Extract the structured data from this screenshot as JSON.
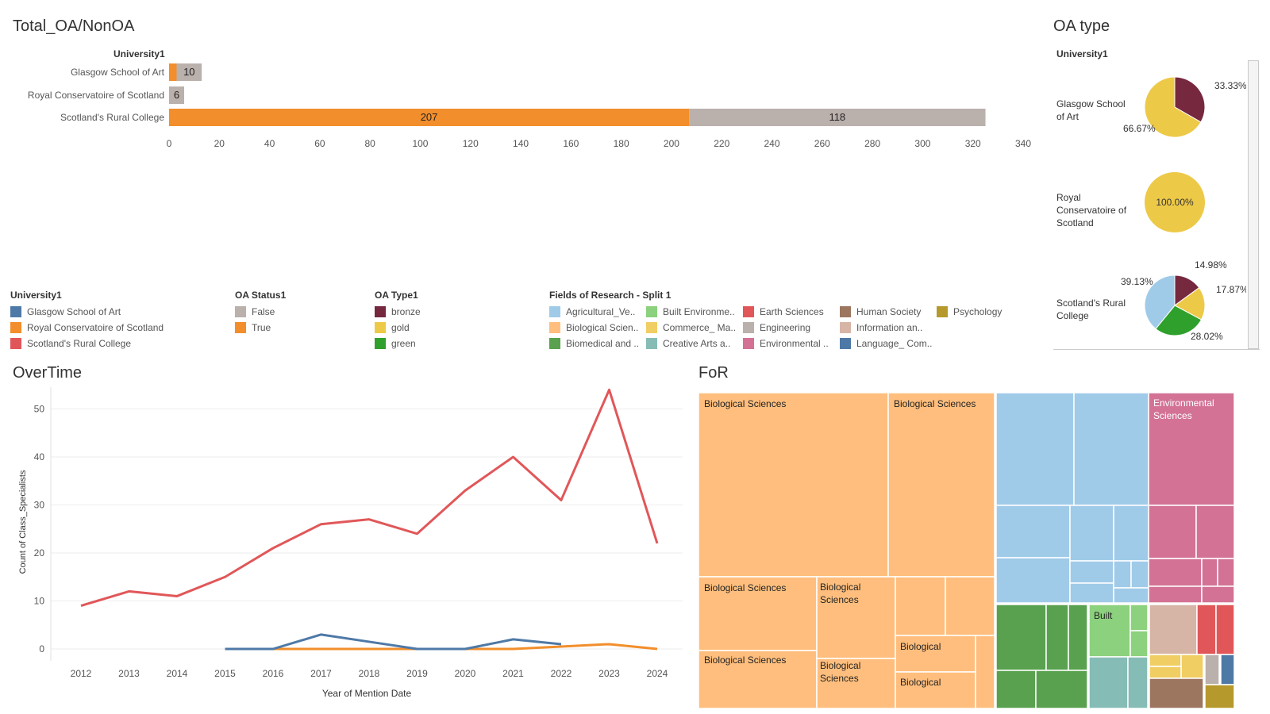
{
  "titles": {
    "total": "Total_OA/NonOA",
    "oa_type": "OA type",
    "overtime": "OverTime",
    "for": "FoR"
  },
  "bar_header": "University1",
  "pie_header": "University1",
  "colors": {
    "oa_true": "#f28e2b",
    "oa_false": "#bab0ac",
    "bronze": "#76283f",
    "gold": "#edc948",
    "green": "#30a02c",
    "glasgow": "#4e79a7",
    "royal": "#f28e2b",
    "rural": "#e15759"
  },
  "legends": {
    "university": {
      "title": "University1",
      "items": [
        {
          "label": "Glasgow School of Art",
          "color": "#4e79a7"
        },
        {
          "label": "Royal Conservatoire of Scotland",
          "color": "#f28e2b"
        },
        {
          "label": "Scotland's Rural College",
          "color": "#e15759"
        }
      ]
    },
    "oa_status": {
      "title": "OA Status1",
      "items": [
        {
          "label": "False",
          "color": "#bab0ac"
        },
        {
          "label": "True",
          "color": "#f28e2b"
        }
      ]
    },
    "oa_type": {
      "title": "OA Type1",
      "items": [
        {
          "label": "bronze",
          "color": "#76283f"
        },
        {
          "label": "gold",
          "color": "#edc948"
        },
        {
          "label": "green",
          "color": "#30a02c"
        }
      ]
    },
    "fields": {
      "title": "Fields of Research - Split 1",
      "items": [
        {
          "label": "Agricultural_Ve..",
          "color": "#a0cbe8"
        },
        {
          "label": "Built Environme..",
          "color": "#8cd17d"
        },
        {
          "label": "Earth Sciences",
          "color": "#e15759"
        },
        {
          "label": "Human Society",
          "color": "#9d7660"
        },
        {
          "label": "Psychology",
          "color": "#b6992d"
        },
        {
          "label": "Biological Scien..",
          "color": "#ffbe7d"
        },
        {
          "label": "Commerce_ Ma..",
          "color": "#f1ce63"
        },
        {
          "label": "Engineering",
          "color": "#bab0ac"
        },
        {
          "label": "Information an..",
          "color": "#d7b5a6"
        },
        {
          "label": "",
          "color": ""
        },
        {
          "label": "Biomedical and ..",
          "color": "#59a14f"
        },
        {
          "label": "Creative Arts a..",
          "color": "#86bcb6"
        },
        {
          "label": "Environmental ..",
          "color": "#d37295"
        },
        {
          "label": "Language_ Com..",
          "color": "#4e79a7"
        },
        {
          "label": "",
          "color": ""
        }
      ]
    }
  },
  "pies": [
    {
      "label": "Glasgow School of Art",
      "labels_text": [
        "33.33%",
        "66.67%"
      ]
    },
    {
      "label": "Royal Conservatoire of Scotland",
      "labels_text": [
        "100.00%"
      ]
    },
    {
      "label": "Scotland's Rural College",
      "labels_text": [
        "14.98%",
        "17.87%",
        "28.02%",
        "39.13%"
      ]
    }
  ],
  "treemap_labels": {
    "bio1": "Biological Sciences",
    "bio2": "Biological Sciences",
    "bio3": "Biological Sciences",
    "bio4": "Biological Sciences",
    "bio5": "Biological Sciences",
    "bio6": "Biological Sciences",
    "bio7": "Biological",
    "bio8": "Biological",
    "env": "Environmental Sciences",
    "built": "Built"
  },
  "chart_data": [
    {
      "type": "bar",
      "title": "Total_OA/NonOA",
      "categories": [
        "Glasgow School of Art",
        "Royal Conservatoire of Scotland",
        "Scotland's Rural College"
      ],
      "series": [
        {
          "name": "True",
          "values": [
            3,
            0,
            207
          ]
        },
        {
          "name": "False",
          "values": [
            10,
            6,
            118
          ]
        }
      ],
      "data_labels": [
        "10",
        "6",
        "207",
        "118"
      ],
      "xlim": [
        0,
        340
      ],
      "x_ticks": [
        "0",
        "20",
        "40",
        "60",
        "80",
        "100",
        "120",
        "140",
        "160",
        "180",
        "200",
        "220",
        "240",
        "260",
        "280",
        "300",
        "320",
        "340"
      ]
    },
    {
      "type": "pie",
      "title": "OA type",
      "charts": [
        {
          "category": "Glasgow School of Art",
          "slices": [
            {
              "name": "bronze",
              "value": 33.33
            },
            {
              "name": "gold",
              "value": 66.67
            }
          ]
        },
        {
          "category": "Royal Conservatoire of Scotland",
          "slices": [
            {
              "name": "gold",
              "value": 100.0
            }
          ]
        },
        {
          "category": "Scotland's Rural College",
          "slices": [
            {
              "name": "bronze",
              "value": 14.98
            },
            {
              "name": "gold",
              "value": 17.87
            },
            {
              "name": "green",
              "value": 28.02
            },
            {
              "name": "agricultural",
              "value": 39.13
            }
          ]
        }
      ]
    },
    {
      "type": "line",
      "title": "OverTime",
      "xlabel": "Year of Mention Date",
      "ylabel": "Count of Class_Specialists",
      "x": [
        "2012",
        "2013",
        "2014",
        "2015",
        "2016",
        "2017",
        "2018",
        "2019",
        "2020",
        "2021",
        "2022",
        "2023",
        "2024"
      ],
      "ylim": [
        0,
        55
      ],
      "y_ticks": [
        "0",
        "10",
        "20",
        "30",
        "40",
        "50"
      ],
      "series": [
        {
          "name": "Scotland's Rural College",
          "color": "#e15759",
          "values": [
            9,
            12,
            11,
            15,
            21,
            26,
            27,
            24,
            33,
            40,
            31,
            54,
            22
          ]
        },
        {
          "name": "Glasgow School of Art",
          "color": "#4e79a7",
          "values": [
            null,
            null,
            null,
            0,
            0,
            3,
            1.5,
            0,
            0,
            2,
            1,
            null,
            null
          ]
        },
        {
          "name": "Royal Conservatoire of Scotland",
          "color": "#f28e2b",
          "values": [
            null,
            null,
            null,
            0,
            0,
            0,
            0,
            0,
            0,
            0,
            0.5,
            1,
            0
          ]
        }
      ]
    }
  ]
}
